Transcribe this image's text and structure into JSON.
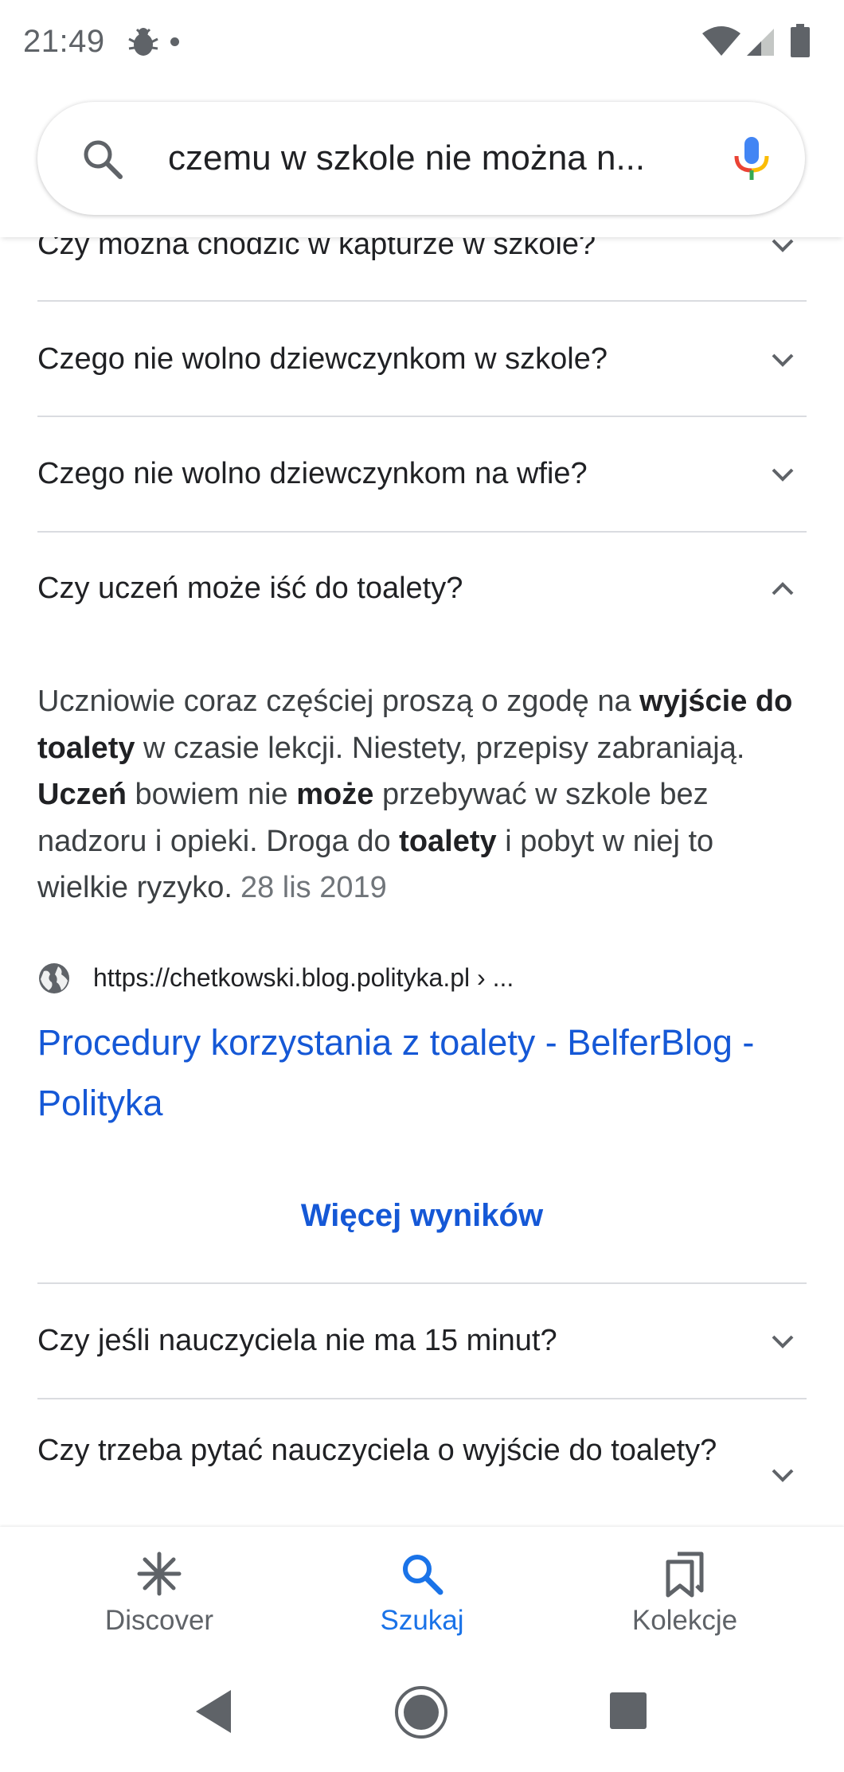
{
  "status": {
    "time": "21:49"
  },
  "search": {
    "query": "czemu w szkole nie można n..."
  },
  "faq_top": [
    {
      "question": "Czy można chodzić w kapturze w szkole?"
    },
    {
      "question": "Czego nie wolno dziewczynkom w szkole?"
    },
    {
      "question": "Czego nie wolno dziewczynkom na wfie?"
    },
    {
      "question": "Czy uczeń może iść do toalety?"
    }
  ],
  "answer": {
    "p1": "Uczniowie coraz częściej proszą o zgodę na ",
    "b1": "wyjście do toalety",
    "p2": " w czasie lekcji. Niestety, przepisy zabraniają. ",
    "b2": "Uczeń",
    "p3": " bowiem nie ",
    "b3": "może",
    "p4": " przebywać w szkole bez nadzoru i opieki. Droga do ",
    "b4": "toalety",
    "p5": " i pobyt w niej to wielkie ryzyko.",
    "date": "28 lis 2019"
  },
  "source": {
    "url": "https://chetkowski.blog.polityka.pl › ...",
    "title": "Procedury korzystania z toalety - BelferBlog - Polityka"
  },
  "more_results": "Więcej wyników",
  "faq_bottom": [
    {
      "question": "Czy jeśli nauczyciela nie ma 15 minut?"
    },
    {
      "question": "Czy trzeba pytać nauczyciela o wyjście do toalety?"
    }
  ],
  "bottom_nav": [
    {
      "label": "Discover",
      "icon": "asterisk-icon"
    },
    {
      "label": "Szukaj",
      "icon": "search-icon",
      "active": true
    },
    {
      "label": "Kolekcje",
      "icon": "bookmarks-icon"
    }
  ],
  "colors": {
    "accent": "#1a73e8",
    "link": "#1558d6",
    "text": "#202124",
    "divider": "#dadce0"
  }
}
